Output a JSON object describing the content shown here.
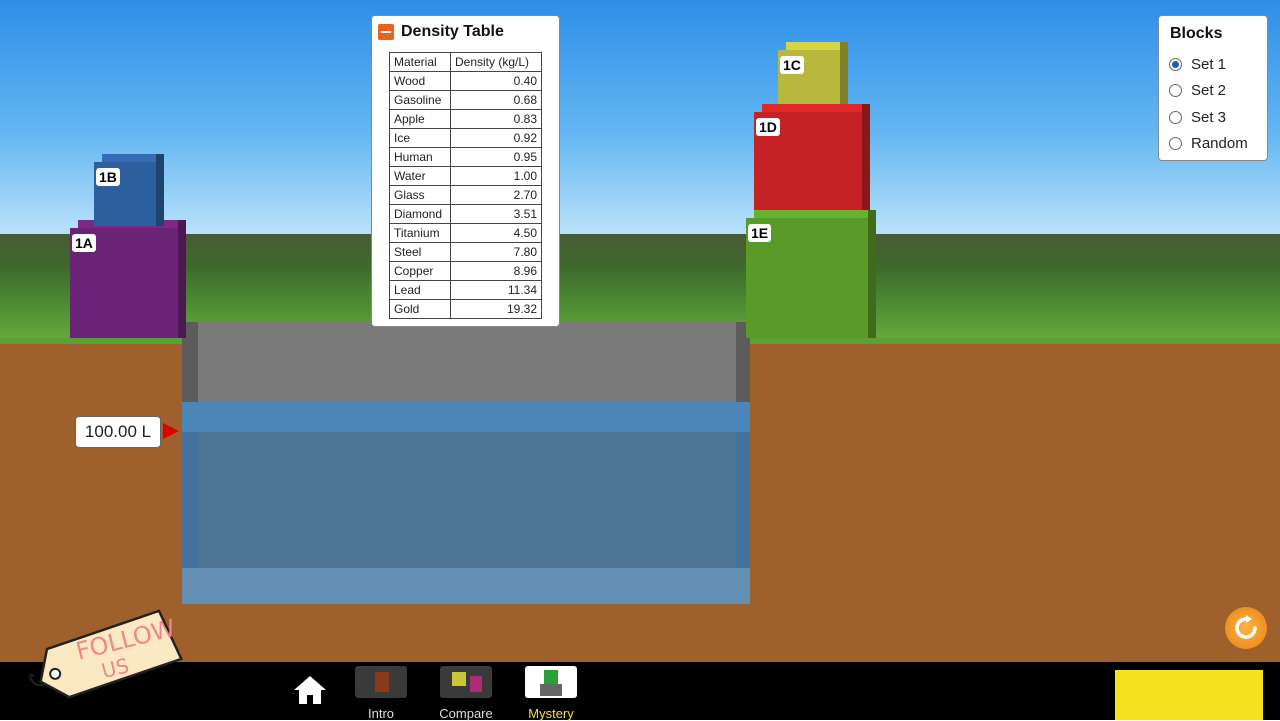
{
  "water": {
    "volume_label": "100.00 L"
  },
  "blocks": [
    {
      "id": "1A",
      "color": "#6b2376"
    },
    {
      "id": "1B",
      "color": "#2d5e9e"
    },
    {
      "id": "1C",
      "color": "#b8b83c"
    },
    {
      "id": "1D",
      "color": "#c42224"
    },
    {
      "id": "1E",
      "color": "#5a9a28"
    }
  ],
  "density_table": {
    "title": "Density Table",
    "headers": [
      "Material",
      "Density (kg/L)"
    ],
    "rows": [
      {
        "material": "Wood",
        "density": "0.40"
      },
      {
        "material": "Gasoline",
        "density": "0.68"
      },
      {
        "material": "Apple",
        "density": "0.83"
      },
      {
        "material": "Ice",
        "density": "0.92"
      },
      {
        "material": "Human",
        "density": "0.95"
      },
      {
        "material": "Water",
        "density": "1.00"
      },
      {
        "material": "Glass",
        "density": "2.70"
      },
      {
        "material": "Diamond",
        "density": "3.51"
      },
      {
        "material": "Titanium",
        "density": "4.50"
      },
      {
        "material": "Steel",
        "density": "7.80"
      },
      {
        "material": "Copper",
        "density": "8.96"
      },
      {
        "material": "Lead",
        "density": "11.34"
      },
      {
        "material": "Gold",
        "density": "19.32"
      }
    ]
  },
  "blocks_panel": {
    "title": "Blocks",
    "options": [
      "Set 1",
      "Set 2",
      "Set 3",
      "Random"
    ],
    "selected": "Set 1"
  },
  "navbar": {
    "home_icon": "home-icon",
    "screens": [
      {
        "label": "Intro",
        "selected": false
      },
      {
        "label": "Compare",
        "selected": false
      },
      {
        "label": "Mystery",
        "selected": true
      }
    ]
  },
  "overlay": {
    "follow_line1": "FOLLOW",
    "follow_line2": "US"
  },
  "colors": {
    "accent": "#e8621c",
    "selected_tab": "#f5e040"
  }
}
